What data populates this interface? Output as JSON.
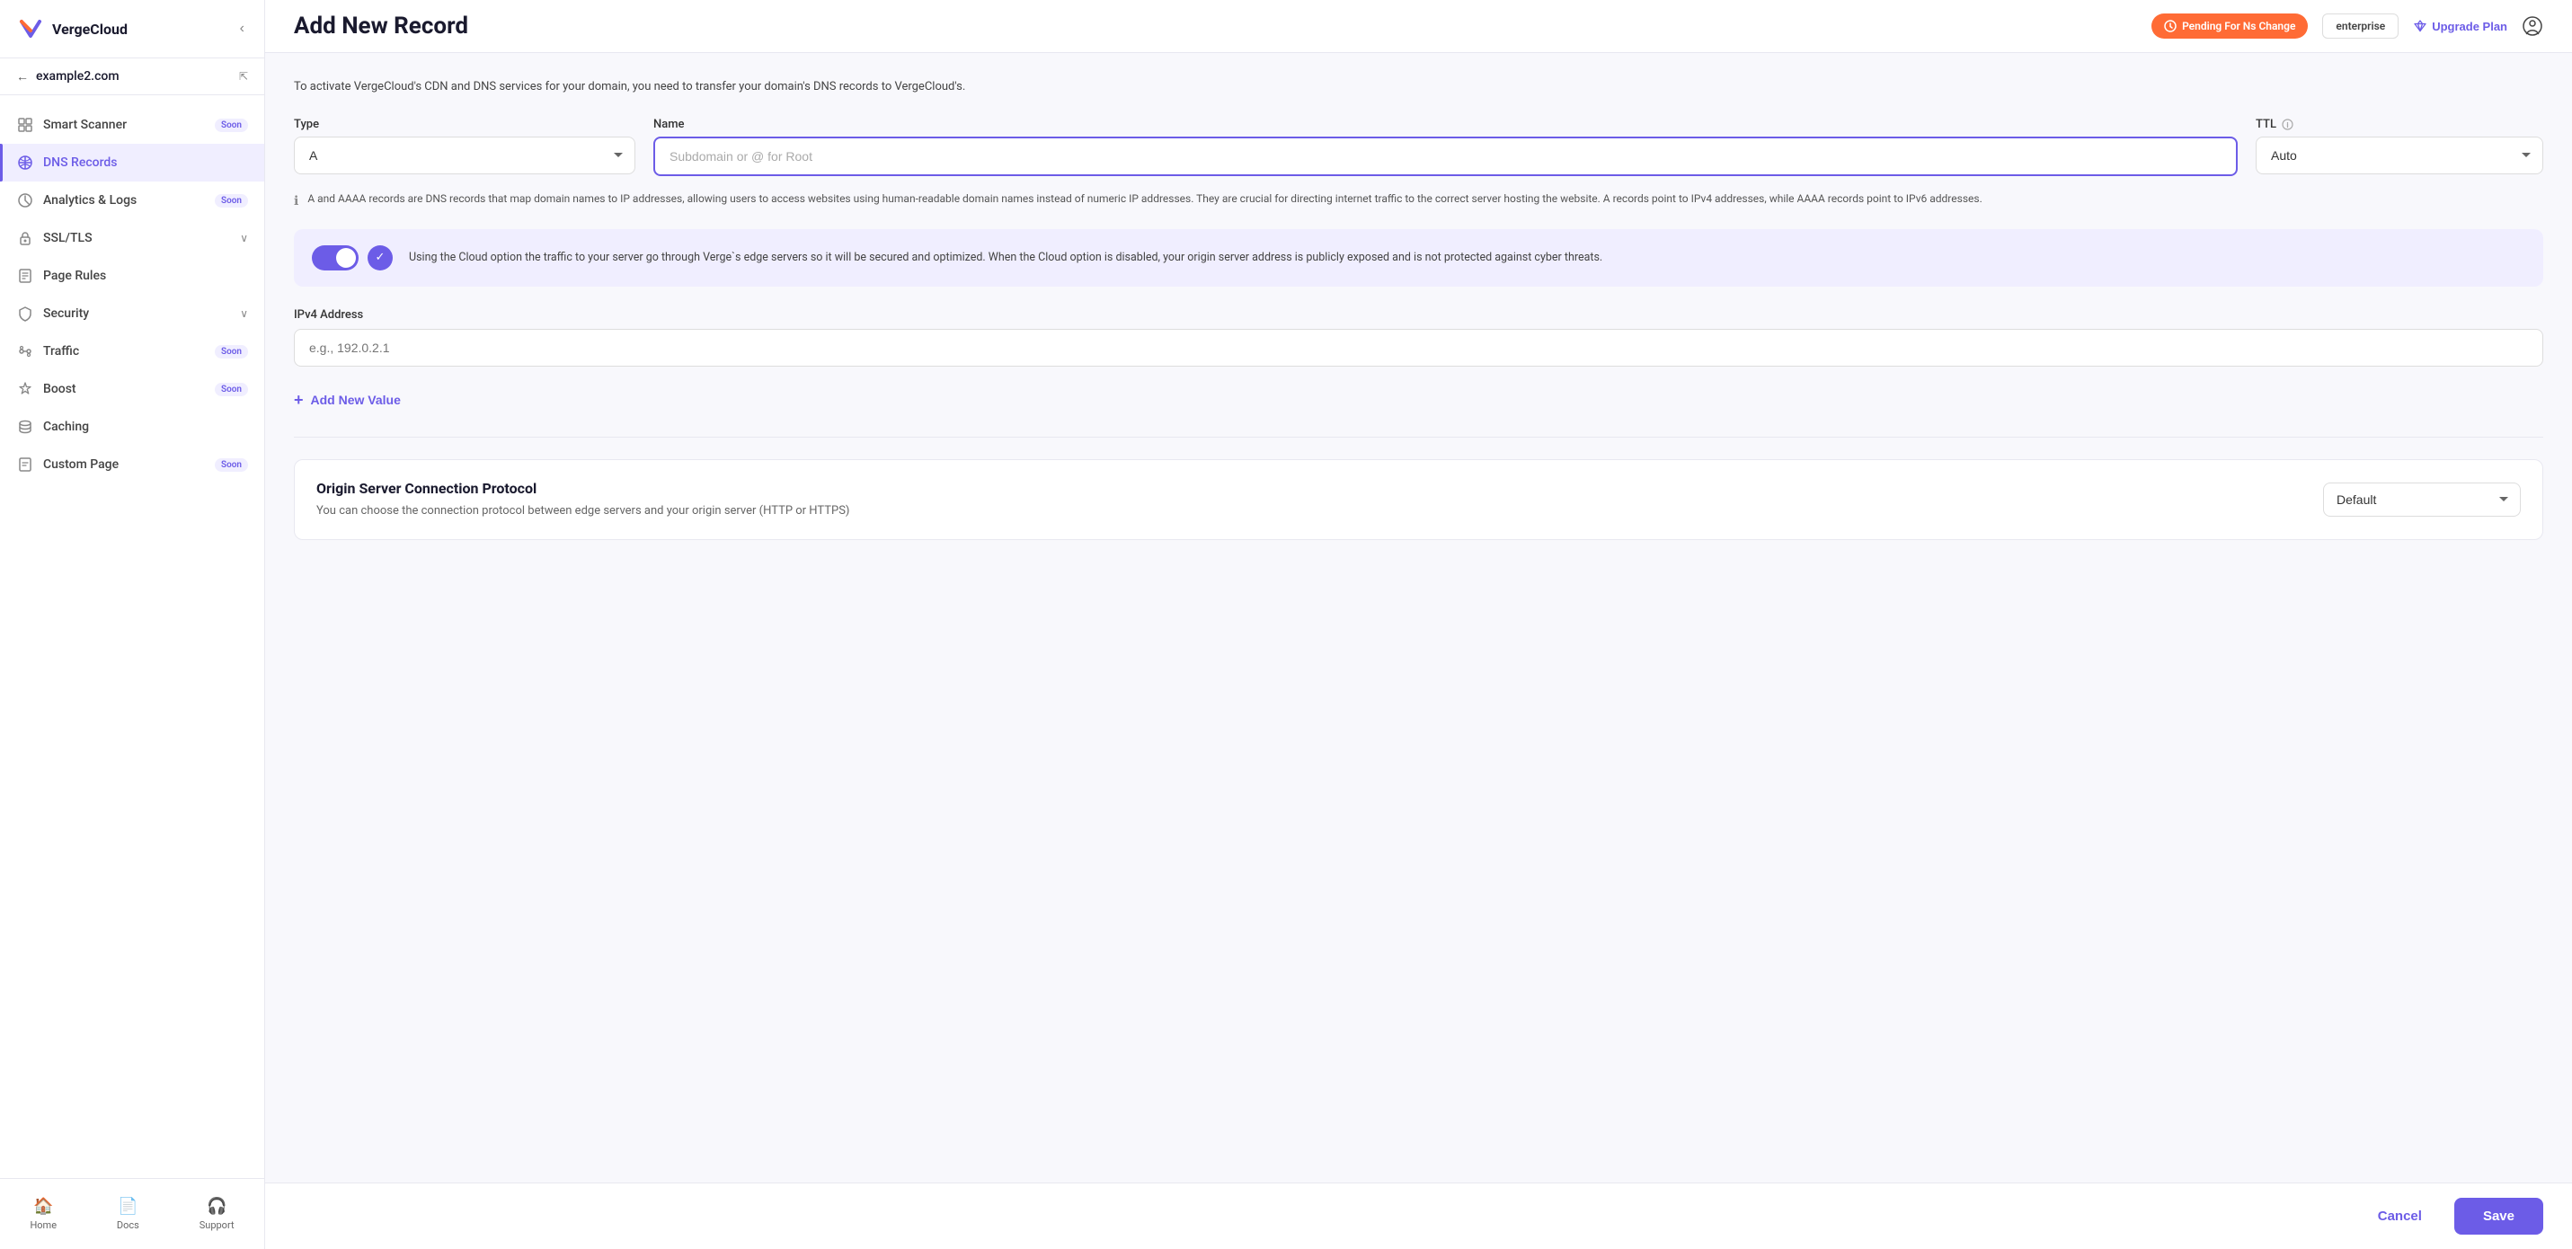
{
  "app": {
    "name": "VergeCloud"
  },
  "sidebar": {
    "collapse_label": "‹",
    "domain": "example2.com",
    "nav_items": [
      {
        "id": "smart-scanner",
        "label": "Smart Scanner",
        "badge": "Soon",
        "active": false,
        "has_chevron": false
      },
      {
        "id": "dns-records",
        "label": "DNS Records",
        "badge": null,
        "active": true,
        "has_chevron": false
      },
      {
        "id": "analytics-logs",
        "label": "Analytics & Logs",
        "badge": "Soon",
        "active": false,
        "has_chevron": false
      },
      {
        "id": "ssl-tls",
        "label": "SSL/TLS",
        "badge": null,
        "active": false,
        "has_chevron": true
      },
      {
        "id": "page-rules",
        "label": "Page Rules",
        "badge": null,
        "active": false,
        "has_chevron": false
      },
      {
        "id": "security",
        "label": "Security",
        "badge": null,
        "active": false,
        "has_chevron": true
      },
      {
        "id": "traffic",
        "label": "Traffic",
        "badge": "Soon",
        "active": false,
        "has_chevron": false
      },
      {
        "id": "boost",
        "label": "Boost",
        "badge": "Soon",
        "active": false,
        "has_chevron": false
      },
      {
        "id": "caching",
        "label": "Caching",
        "badge": null,
        "active": false,
        "has_chevron": false
      },
      {
        "id": "custom-page",
        "label": "Custom Page",
        "badge": "Soon",
        "active": false,
        "has_chevron": false
      }
    ],
    "footer_items": [
      {
        "id": "home",
        "label": "Home",
        "icon": "🏠"
      },
      {
        "id": "docs",
        "label": "Docs",
        "icon": "📄"
      },
      {
        "id": "support",
        "label": "Support",
        "icon": "🎧"
      }
    ]
  },
  "header": {
    "title": "Add New Record",
    "pending_badge": "Pending For Ns Change",
    "enterprise_label": "enterprise",
    "upgrade_label": "Upgrade Plan"
  },
  "form": {
    "info_text": "To activate VergeCloud's CDN and DNS services for your domain, you need to transfer your domain's DNS records to VergeCloud's.",
    "type_label": "Type",
    "type_value": "A",
    "name_label": "Name",
    "name_placeholder": "Subdomain or @ for Root",
    "ttl_label": "TTL",
    "ttl_value": "Auto",
    "dns_note": "A and AAAA records are DNS records that map domain names to IP addresses, allowing users to access websites using human-readable domain names instead of numeric IP addresses. They are crucial for directing internet traffic to the correct server hosting the website. A records point to IPv4 addresses, while AAAA records point to IPv6 addresses.",
    "cloud_toggle_text": "Using the Cloud option the traffic to your server go through Verge`s edge servers so it will be secured and optimized. When the Cloud option is disabled, your origin server address is publicly exposed and is not protected against cyber threats.",
    "ipv4_label": "IPv4 Address",
    "ipv4_placeholder": "e.g., 192.0.2.1",
    "add_value_label": "Add New Value",
    "protocol_title": "Origin Server Connection Protocol",
    "protocol_desc": "You can choose the connection protocol between edge servers and your origin server (HTTP or HTTPS)",
    "protocol_value": "Default",
    "cancel_label": "Cancel",
    "save_label": "Save"
  }
}
